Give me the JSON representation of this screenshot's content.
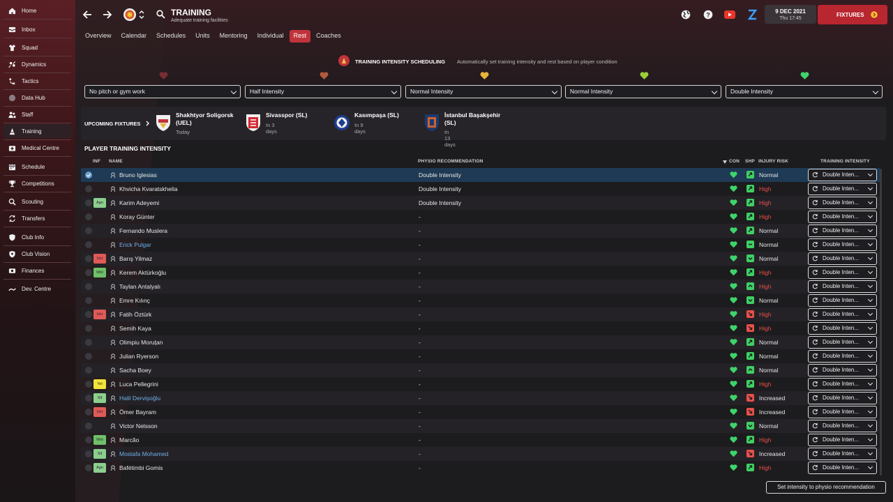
{
  "sidebar": {
    "items": [
      {
        "label": "Home",
        "icon": "home-icon"
      },
      {
        "label": "Inbox",
        "icon": "inbox-icon"
      },
      {
        "label": "Squad",
        "icon": "shirt-icon"
      },
      {
        "label": "Dynamics",
        "icon": "dynamics-icon"
      },
      {
        "label": "Tactics",
        "icon": "tactics-icon"
      },
      {
        "label": "Data Hub",
        "icon": "data-hub-icon"
      },
      {
        "label": "Staff",
        "icon": "staff-icon"
      },
      {
        "label": "Training",
        "icon": "training-cone-icon"
      },
      {
        "label": "Medical Centre",
        "icon": "medical-icon"
      },
      {
        "label": "Schedule",
        "icon": "calendar-icon"
      },
      {
        "label": "Competitions",
        "icon": "trophy-icon"
      },
      {
        "label": "Scouting",
        "icon": "search-icon"
      },
      {
        "label": "Transfers",
        "icon": "transfer-icon"
      },
      {
        "label": "Club Info",
        "icon": "shield-icon"
      },
      {
        "label": "Club Vision",
        "icon": "club-vision-icon"
      },
      {
        "label": "Finances",
        "icon": "money-icon"
      },
      {
        "label": "Dev. Centre",
        "icon": "dev-centre-icon"
      }
    ],
    "active": "Training"
  },
  "header": {
    "title": "TRAINING",
    "subtitle": "Adequate training facilities",
    "date": "9 DEC 2021",
    "time": "Thu 17:45",
    "fixtures_button": "FIXTURES"
  },
  "tabs": [
    "Overview",
    "Calendar",
    "Schedules",
    "Units",
    "Mentoring",
    "Individual",
    "Rest",
    "Coaches"
  ],
  "active_tab": "Rest",
  "scheduling": {
    "title": "TRAINING INTENSITY SCHEDULING",
    "description": "Automatically set training intensity and rest based on player condition",
    "heart_colors": [
      "#7a2c33",
      "#b45a3c",
      "#e8b43a",
      "#9ccd3a",
      "#3fd36b"
    ],
    "options": [
      "No pitch or gym work",
      "Half Intensity",
      "Normal Intensity",
      "Normal Intensity",
      "Double Intensity"
    ]
  },
  "upcoming": {
    "label": "UPCOMING FIXTURES",
    "fixtures": [
      {
        "name": "Shakhtyor Soligorsk\n(UEL)",
        "when": "Today"
      },
      {
        "name": "Sivasspor (SL)",
        "when": "In 3 days"
      },
      {
        "name": "Kasımpaşa (SL)",
        "when": "In 9 days"
      },
      {
        "name": "İstanbul Başakşehir\n(SL)",
        "when": "In 13 days"
      }
    ]
  },
  "table": {
    "title": "PLAYER TRAINING INTENSITY",
    "headers": {
      "inf": "INF",
      "name": "NAME",
      "physio": "PHYSIO RECOMMENDATION",
      "con": "CON",
      "shp": "SHP",
      "risk": "INJURY RISK",
      "intensity": "TRAINING INTENSITY"
    },
    "rows": [
      {
        "inf": "",
        "name": "Bruno Iglesias",
        "physio": "Double Intensity",
        "shp": "up",
        "risk": "Normal",
        "intensity": "Double Inten...",
        "blue": false
      },
      {
        "inf": "",
        "name": "Khvicha Kvaratskhelia",
        "physio": "Double Intensity",
        "shp": "up",
        "risk": "High",
        "intensity": "Double Inten...",
        "blue": false
      },
      {
        "inf": "Agn",
        "name": "Karim Adeyemi",
        "physio": "Double Intensity",
        "shp": "up",
        "risk": "High",
        "intensity": "Double Inten...",
        "blue": false
      },
      {
        "inf": "",
        "name": "Koray Günter",
        "physio": "-",
        "shp": "up",
        "risk": "High",
        "intensity": "Double Inten...",
        "blue": false
      },
      {
        "inf": "",
        "name": "Fernando Muslera",
        "physio": "-",
        "shp": "up",
        "risk": "Normal",
        "intensity": "Double Inten...",
        "blue": false
      },
      {
        "inf": "",
        "name": "Erick Pulgar",
        "physio": "-",
        "shp": "flat",
        "risk": "Normal",
        "intensity": "Double Inten...",
        "blue": true
      },
      {
        "inf": "Unr",
        "name": "Barış Yilmaz",
        "physio": "-",
        "shp": "down",
        "risk": "Normal",
        "intensity": "Double Inten...",
        "blue": false
      },
      {
        "inf": "Wnt",
        "name": "Kerem Aktürkoğlu",
        "physio": "-",
        "shp": "up",
        "risk": "High",
        "intensity": "Double Inten...",
        "blue": false
      },
      {
        "inf": "",
        "name": "Taylan Antalyalı",
        "physio": "-",
        "shp": "up2",
        "risk": "High",
        "intensity": "Double Inten...",
        "blue": false
      },
      {
        "inf": "",
        "name": "Emre Kılınç",
        "physio": "-",
        "shp": "down",
        "risk": "Normal",
        "intensity": "Double Inten...",
        "blue": false
      },
      {
        "inf": "Unr",
        "name": "Fatih Öztürk",
        "physio": "-",
        "shp": "red",
        "risk": "High",
        "intensity": "Double Inten...",
        "blue": false
      },
      {
        "inf": "",
        "name": "Semih Kaya",
        "physio": "-",
        "shp": "red",
        "risk": "High",
        "intensity": "Double Inten...",
        "blue": false
      },
      {
        "inf": "",
        "name": "Olimpiu Moruțan",
        "physio": "-",
        "shp": "up",
        "risk": "Normal",
        "intensity": "Double Inten...",
        "blue": false
      },
      {
        "inf": "",
        "name": "Julian Ryerson",
        "physio": "-",
        "shp": "up",
        "risk": "Normal",
        "intensity": "Double Inten...",
        "blue": false
      },
      {
        "inf": "",
        "name": "Sacha Boey",
        "physio": "-",
        "shp": "up2",
        "risk": "Normal",
        "intensity": "Double Inten...",
        "blue": false
      },
      {
        "inf": "Yel",
        "name": "Luca Pellegrini",
        "physio": "-",
        "shp": "up",
        "risk": "High",
        "intensity": "Double Inten...",
        "blue": false
      },
      {
        "inf": "Slt",
        "name": "Halil Dervişoğlu",
        "physio": "-",
        "shp": "red",
        "risk": "Increased",
        "intensity": "Double Inten...",
        "blue": true
      },
      {
        "inf": "Unr",
        "name": "Ömer Bayram",
        "physio": "-",
        "shp": "red",
        "risk": "Increased",
        "intensity": "Double Inten...",
        "blue": false
      },
      {
        "inf": "",
        "name": "Victor Nelsson",
        "physio": "-",
        "shp": "down",
        "risk": "Normal",
        "intensity": "Double Inten...",
        "blue": false
      },
      {
        "inf": "Wnt",
        "name": "Marcão",
        "physio": "-",
        "shp": "up",
        "risk": "High",
        "intensity": "Double Inten...",
        "blue": false
      },
      {
        "inf": "Slt",
        "name": "Mostafa Mohamed",
        "physio": "-",
        "shp": "red",
        "risk": "Increased",
        "intensity": "Double Inten...",
        "blue": true
      },
      {
        "inf": "Agn",
        "name": "Bafétimbi Gomis",
        "physio": "-",
        "shp": "up",
        "risk": "High",
        "intensity": "Double Inten...",
        "blue": false
      }
    ]
  },
  "footer_button": "Set intensity to physio recommendation",
  "colors": {
    "accent": "#c0333b",
    "risk_high": "#e8504a",
    "risk_normal": "#e6e6e6",
    "con_green": "#3fd36b",
    "selected_row": "#1e3a54"
  }
}
